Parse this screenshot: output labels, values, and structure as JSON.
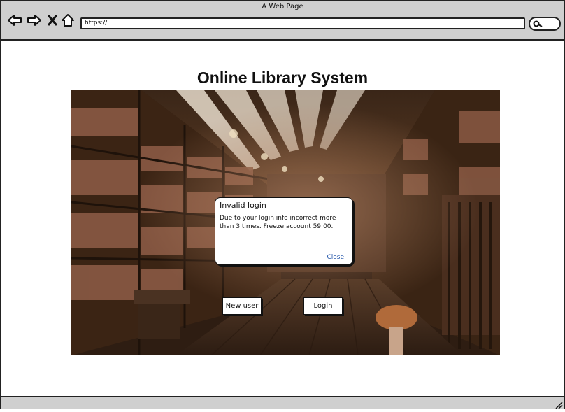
{
  "browser": {
    "window_title": "A Web Page",
    "url": "https://"
  },
  "page": {
    "title": "Online Library System"
  },
  "buttons": {
    "new_user": "New user",
    "login": "Login"
  },
  "dialog": {
    "title": "Invalid login",
    "message": "Due to your login info incorrect more than 3 times. Freeze account 59:00.",
    "close": "Close"
  }
}
